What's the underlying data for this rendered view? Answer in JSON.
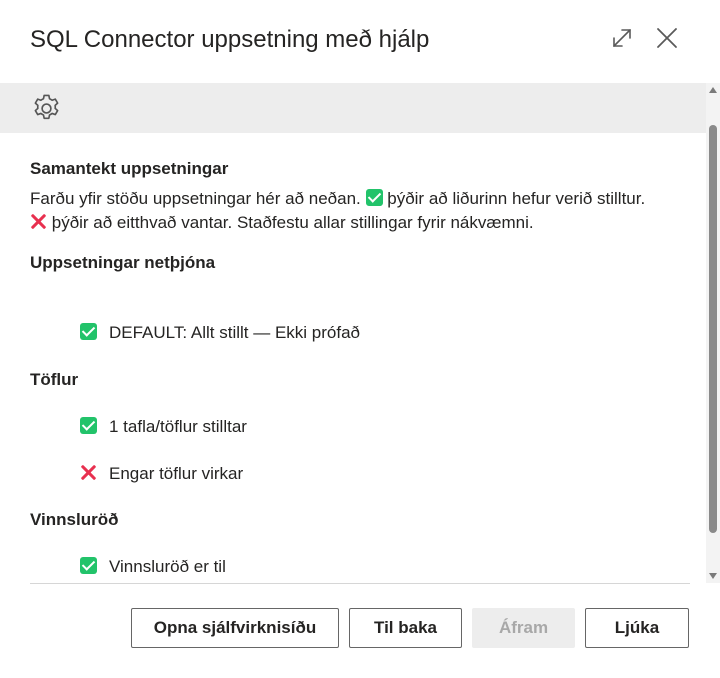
{
  "dialog": {
    "title": "SQL Connector uppsetning með hjálp",
    "expand_icon": "expand-icon",
    "close_icon": "close-icon"
  },
  "settings_bar": {
    "icon": "gear-icon"
  },
  "summary": {
    "heading": "Samantekt uppsetningar",
    "line1_before": "Farðu yfir stöðu uppsetningar hér að neðan.",
    "line1_after": "þýðir að liðurinn hefur verið stilltur.",
    "line2_after": "þýðir að eitthvað vantar. Staðfestu allar stillingar fyrir nákvæmni."
  },
  "sections": {
    "servers": {
      "heading": "Uppsetningar netþjóna",
      "items": [
        {
          "status": "ok",
          "text": "DEFAULT: Allt stillt — Ekki prófað"
        }
      ]
    },
    "tables": {
      "heading": "Töflur",
      "items": [
        {
          "status": "ok",
          "text": "1 tafla/töflur stilltar"
        },
        {
          "status": "missing",
          "text": "Engar töflur virkar"
        }
      ]
    },
    "processing": {
      "heading": "Vinnsluröð",
      "items": [
        {
          "status": "ok",
          "text": "Vinnsluröð er til"
        }
      ]
    }
  },
  "colors": {
    "ok": "#22c36a",
    "missing": "#e8304f",
    "bar": "#ededed"
  },
  "footer": {
    "open_automation": "Opna sjálfvirknisíðu",
    "back": "Til baka",
    "next": "Áfram",
    "finish": "Ljúka"
  }
}
